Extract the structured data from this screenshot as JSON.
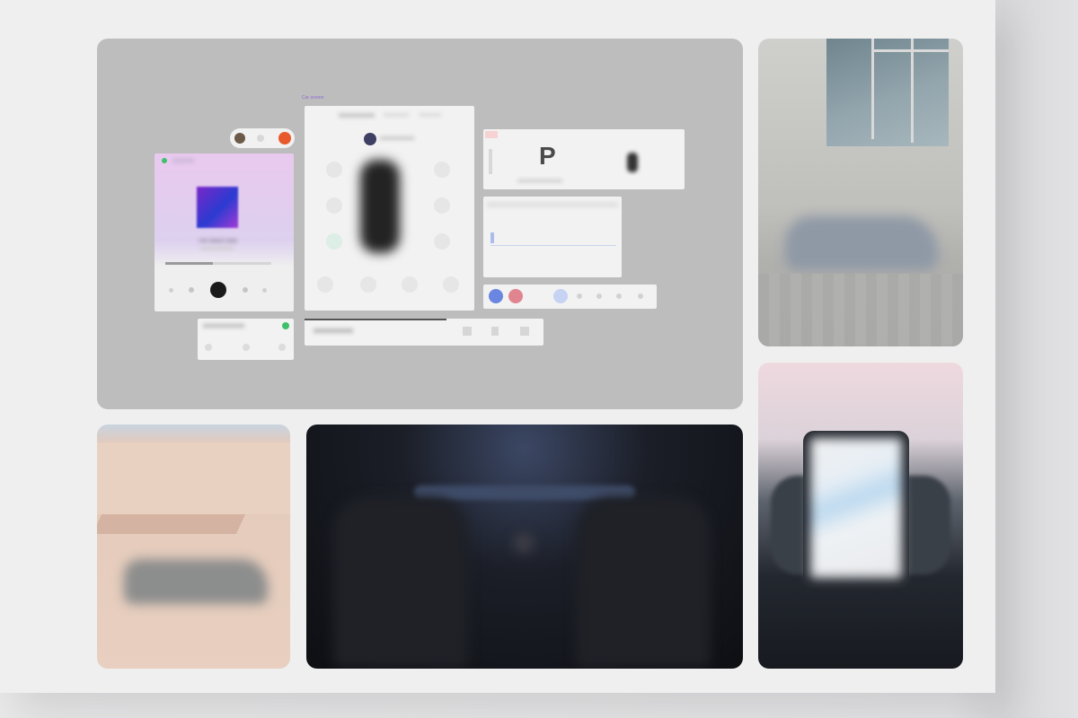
{
  "tiles": {
    "board": {
      "label": "Car screen",
      "music_widget": {
        "track": "The Stand Clear"
      },
      "gear": {
        "value": "P"
      }
    },
    "building": {},
    "desert": {},
    "interior": {},
    "dashboard": {}
  },
  "colors": {
    "board_bg": "#bdbdbd",
    "accent_purple": "#8e6bd6",
    "accent_orange": "#e8592b",
    "accent_green": "#3fc06a",
    "accent_blue": "#6a86e0",
    "accent_pink": "#e0858f"
  }
}
